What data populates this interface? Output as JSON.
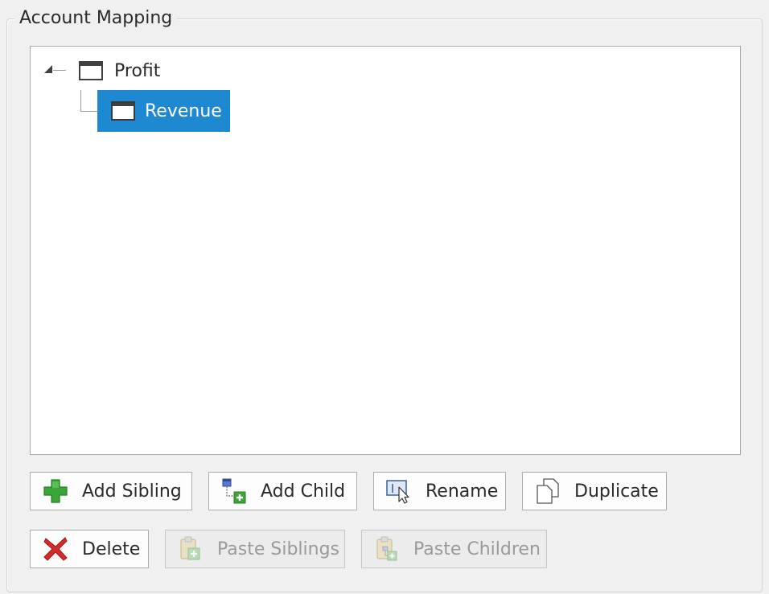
{
  "group": {
    "title": "Account Mapping"
  },
  "tree": {
    "root": {
      "label": "Profit",
      "icon": "window-icon",
      "expanded": true
    },
    "children": [
      {
        "label": "Revenue",
        "icon": "window-icon",
        "selected": true
      }
    ]
  },
  "buttons": {
    "add_sibling": {
      "label": "Add Sibling",
      "icon": "green-plus-icon"
    },
    "add_child": {
      "label": "Add Child",
      "icon": "add-child-icon"
    },
    "rename": {
      "label": "Rename",
      "icon": "rename-cursor-icon"
    },
    "duplicate": {
      "label": "Duplicate",
      "icon": "duplicate-pages-icon"
    },
    "delete": {
      "label": "Delete",
      "icon": "red-x-icon"
    },
    "paste_siblings": {
      "label": "Paste Siblings",
      "icon": "paste-clipboard-plus-icon",
      "disabled": true
    },
    "paste_children": {
      "label": "Paste Children",
      "icon": "paste-clipboard-child-icon",
      "disabled": true
    }
  },
  "colors": {
    "selection": "#1e88d0",
    "background": "#f0f0f0",
    "plus_green": "#3aa635",
    "delete_red": "#d42a2a"
  }
}
